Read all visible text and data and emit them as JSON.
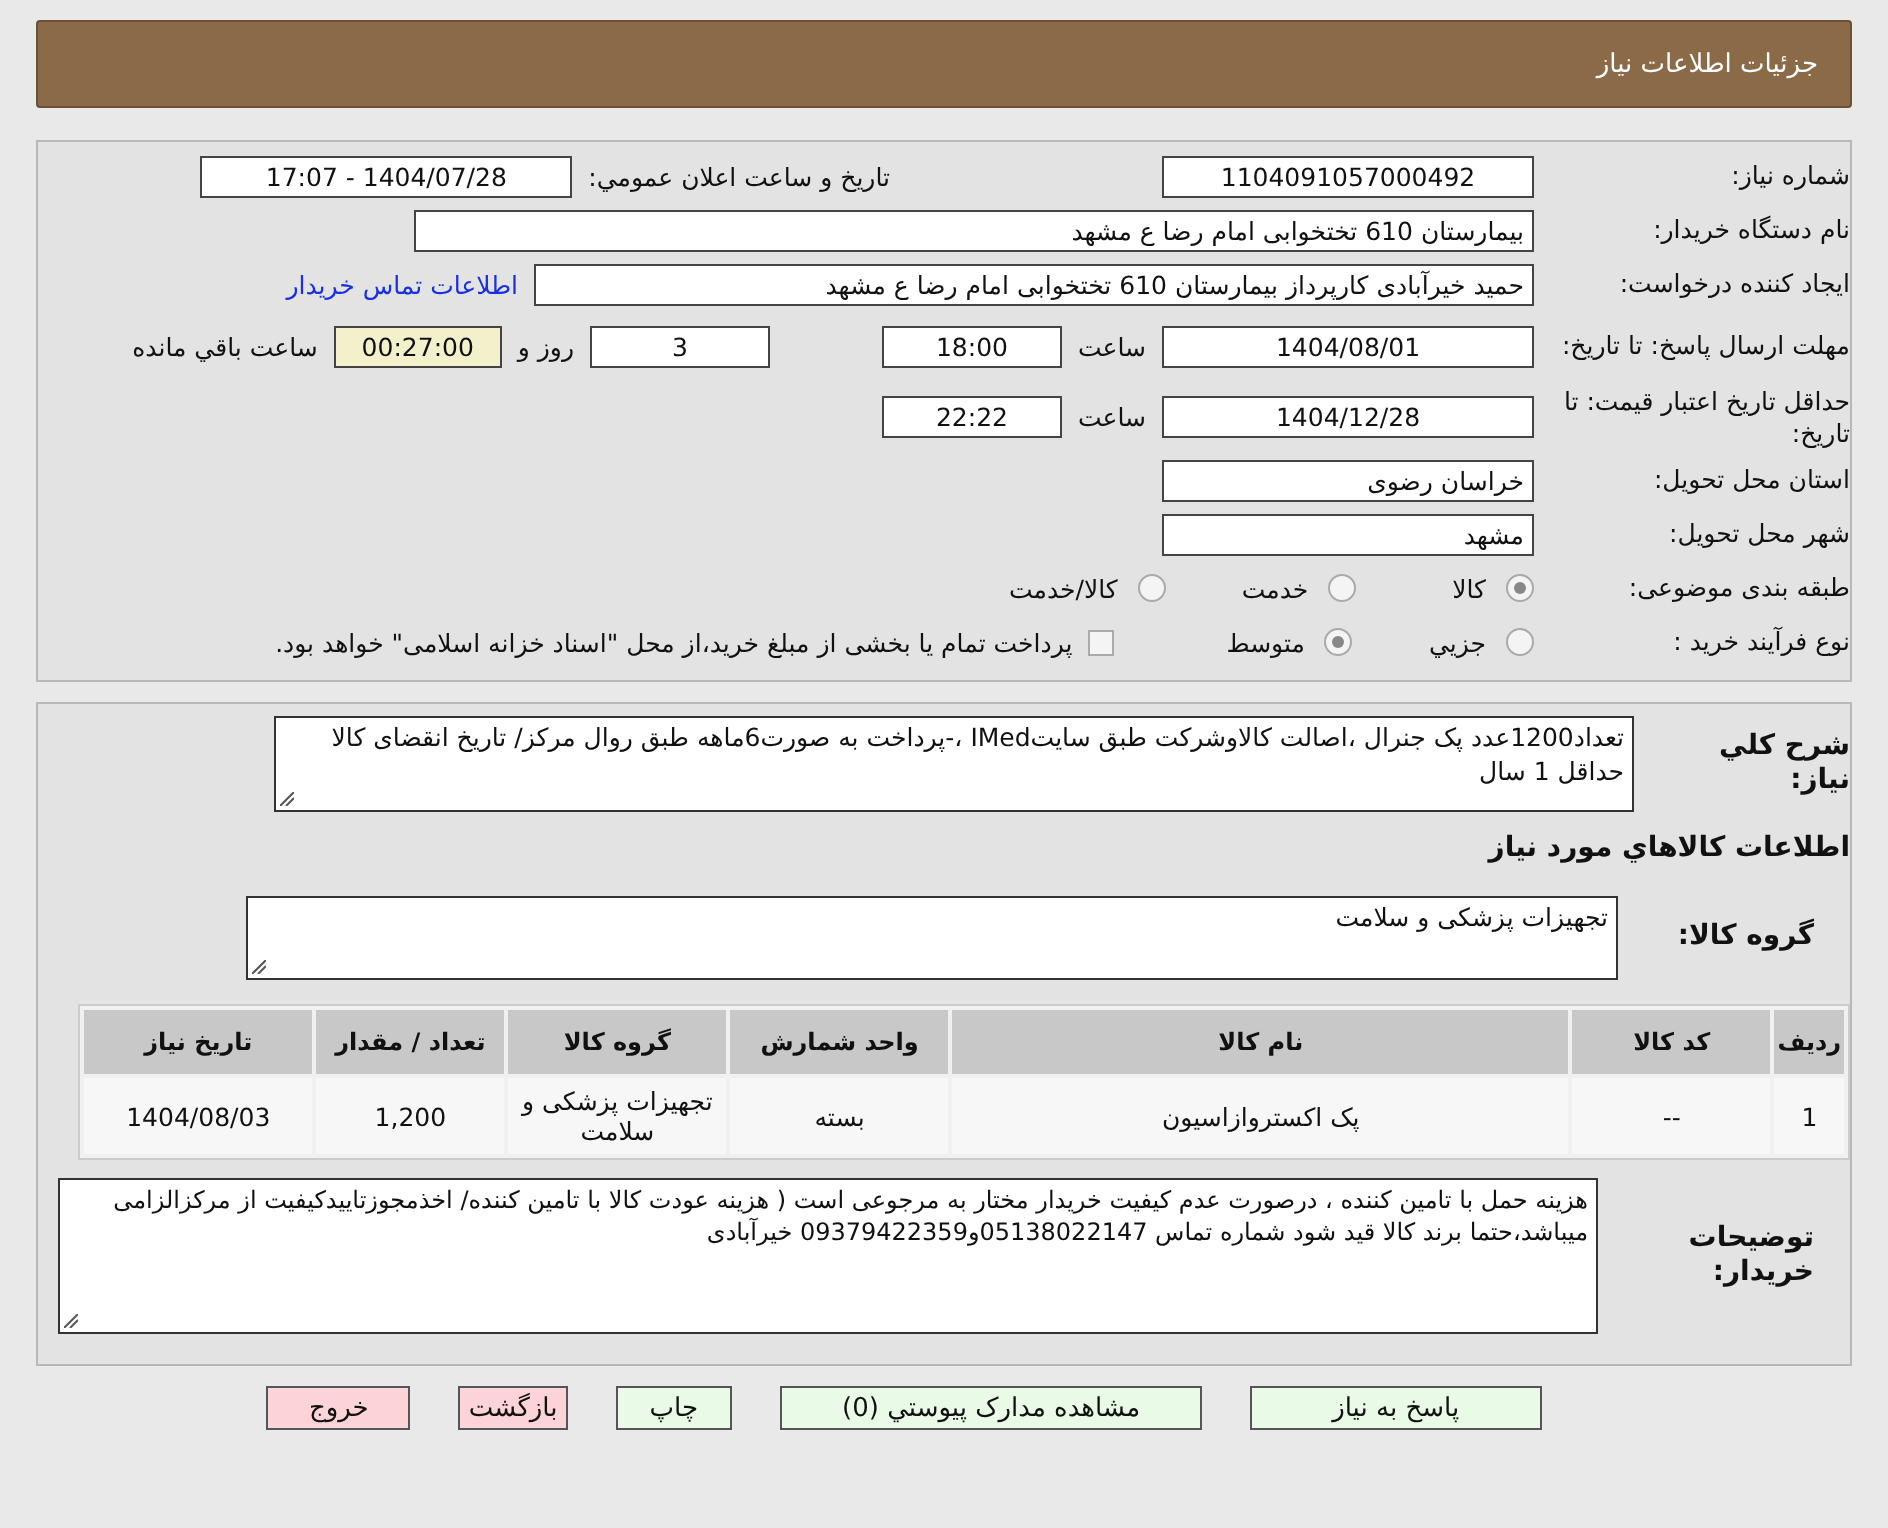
{
  "header": {
    "title": "جزئیات اطلاعات نیاز"
  },
  "need_number": {
    "label": "شماره نیاز:",
    "value": "1104091057000492"
  },
  "announce": {
    "label": "تاریخ و ساعت اعلان عمومي:",
    "value": "1404/07/28 - 17:07"
  },
  "buyer_org": {
    "label": "نام دستگاه خریدار:",
    "value": "بیمارستان 610 تختخوابی امام رضا ع  مشهد"
  },
  "requester": {
    "label": "ایجاد کننده درخواست:",
    "value": "حمید خیرآبادی کارپرداز بیمارستان 610 تختخوابی امام رضا ع  مشهد",
    "link": "اطلاعات تماس خریدار"
  },
  "deadline": {
    "label": "مهلت ارسال پاسخ: تا تاریخ:",
    "date": "1404/08/01",
    "time_label": "ساعت",
    "time": "18:00",
    "days": "3",
    "days_label": "روز و",
    "remaining": "00:27:00",
    "remaining_label": "ساعت باقي مانده"
  },
  "validity": {
    "label": "حداقل تاریخ اعتبار قیمت: تا تاریخ:",
    "date": "1404/12/28",
    "time_label": "ساعت",
    "time": "22:22"
  },
  "province": {
    "label": "استان محل تحویل:",
    "value": "خراسان رضوی"
  },
  "city": {
    "label": "شهر محل تحویل:",
    "value": "مشهد"
  },
  "category": {
    "label": "طبقه بندی موضوعی:",
    "options": [
      {
        "label": "کالا",
        "selected": true
      },
      {
        "label": "خدمت",
        "selected": false
      },
      {
        "label": "کالا/خدمت",
        "selected": false
      }
    ]
  },
  "process": {
    "label": "نوع فرآیند خرید :",
    "options": [
      {
        "label": "جزيي",
        "selected": false
      },
      {
        "label": "متوسط",
        "selected": true
      }
    ],
    "payment": {
      "checked": false,
      "text": "پرداخت تمام یا بخشی از مبلغ خرید،از محل \"اسناد خزانه اسلامی\" خواهد بود."
    }
  },
  "description": {
    "label": "شرح کلي نیاز:",
    "value": "تعداد1200عدد پک جنرال ،اصالت کالاوشرکت طبق سایتIMed ،-پرداخت به صورت6ماهه طبق روال مرکز/ تاریخ انقضای کالا حداقل 1 سال"
  },
  "goods_heading": "اطلاعات کالاهاي مورد نیاز",
  "goods_group": {
    "label": "گروه کالا:",
    "value": "تجهیزات پزشکی و سلامت"
  },
  "table": {
    "columns": [
      "ردیف",
      "کد کالا",
      "نام کالا",
      "واحد شمارش",
      "گروه کالا",
      "تعداد / مقدار",
      "تاریخ نیاز"
    ],
    "rows": [
      [
        "1",
        "--",
        "پک اکستروازاسیون",
        "بسته",
        "تجهیزات پزشکی و سلامت",
        "1,200",
        "1404/08/03"
      ]
    ]
  },
  "buyer_notes": {
    "label": "توضیحات خریدار:",
    "value": "هزینه حمل با تامین کننده ، درصورت عدم کیفیت خریدار مختار به مرجوعی است ( هزینه عودت کالا با تامین کننده/ اخذمجوزتاییدکیفیت از مرکزالزامی میباشد،حتما برند کالا قید شود شماره تماس 05138022147و09379422359 خیرآبادی"
  },
  "buttons": [
    {
      "label": "پاسخ به نیاز",
      "kind": "action"
    },
    {
      "label": "مشاهده مدارک پیوستي (0)",
      "kind": "action"
    },
    {
      "label": "چاپ",
      "kind": "action"
    },
    {
      "label": "بازگشت",
      "kind": "exit"
    },
    {
      "label": "خروج",
      "kind": "exit"
    }
  ]
}
